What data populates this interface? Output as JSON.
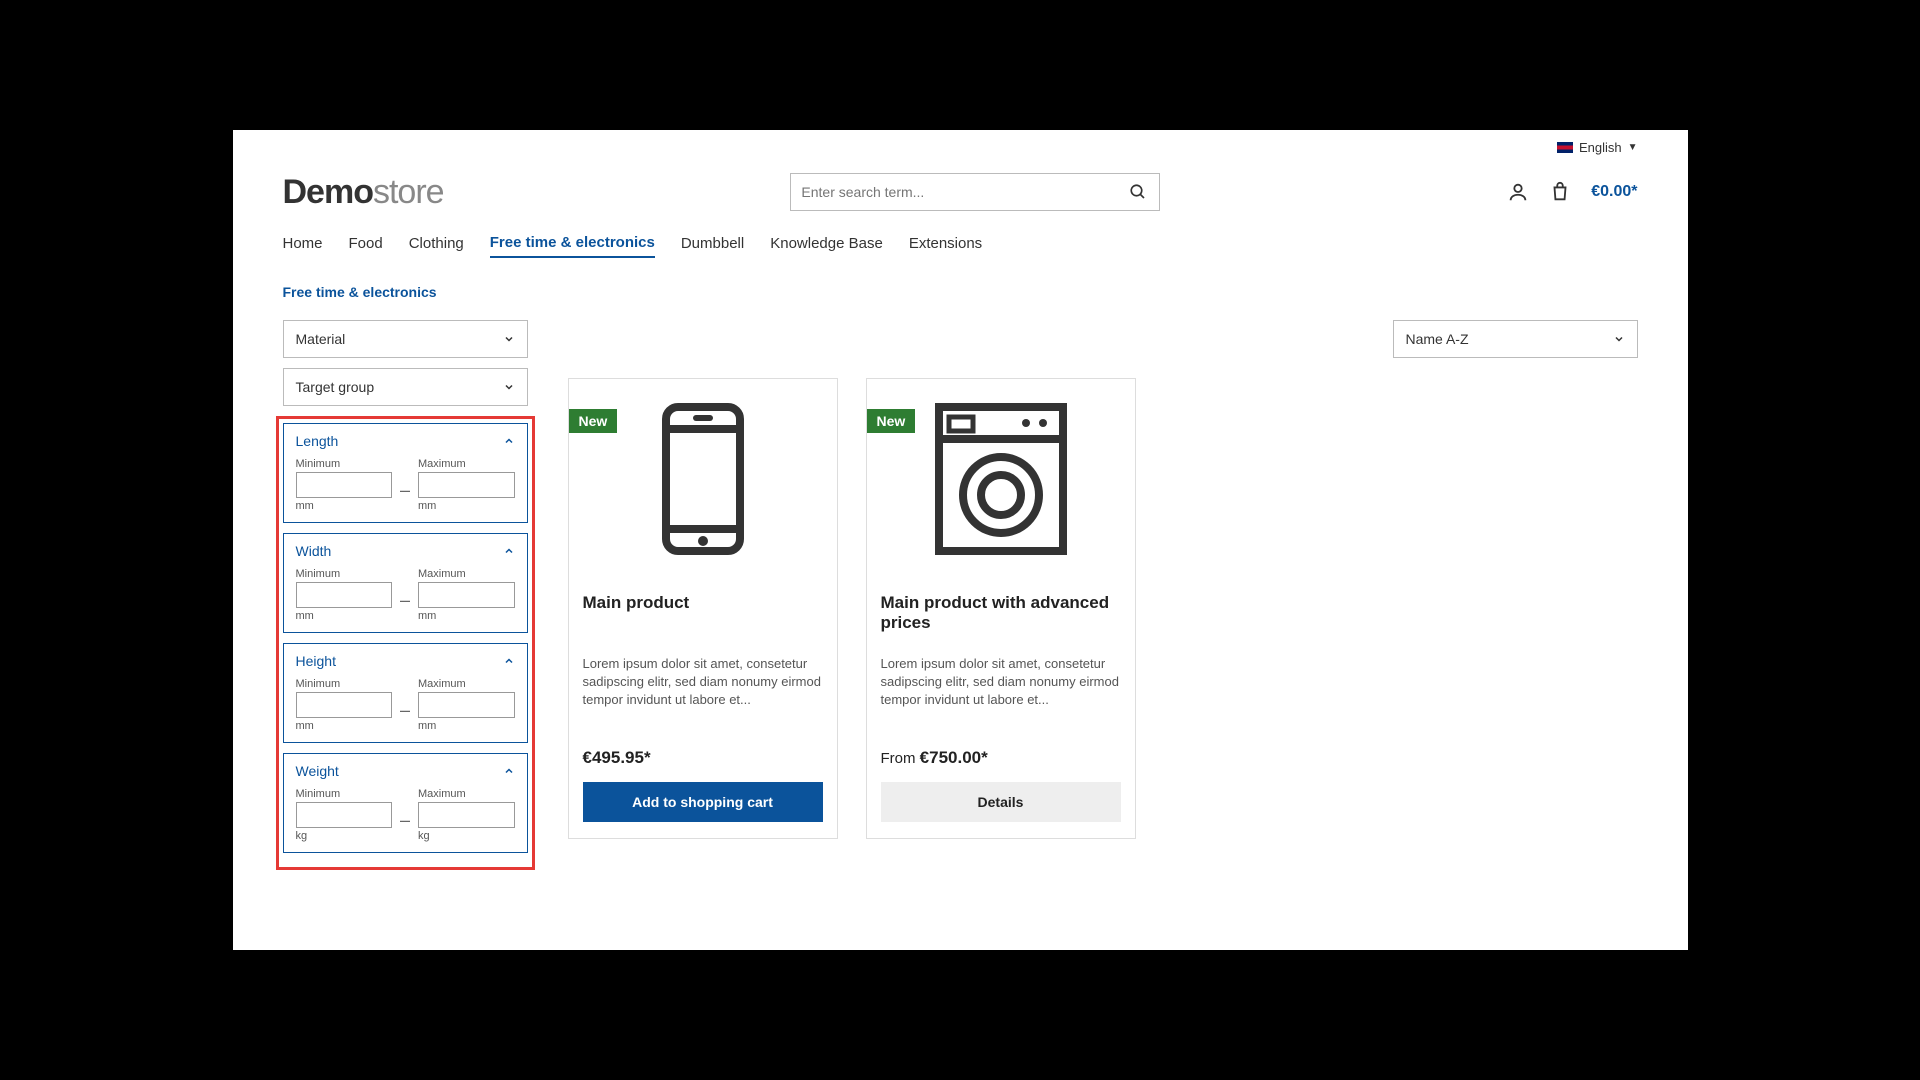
{
  "topbar": {
    "language": "English"
  },
  "logo": {
    "bold": "Demo",
    "light": "store"
  },
  "search": {
    "placeholder": "Enter search term..."
  },
  "cart": {
    "total": "€0.00*"
  },
  "nav": {
    "items": [
      "Home",
      "Food",
      "Clothing",
      "Free time & electronics",
      "Dumbbell",
      "Knowledge Base",
      "Extensions"
    ],
    "active_index": 3
  },
  "breadcrumb": "Free time & electronics",
  "filters": {
    "collapsed": [
      "Material",
      "Target group"
    ],
    "range": [
      {
        "label": "Length",
        "min_label": "Minimum",
        "max_label": "Maximum",
        "unit": "mm"
      },
      {
        "label": "Width",
        "min_label": "Minimum",
        "max_label": "Maximum",
        "unit": "mm"
      },
      {
        "label": "Height",
        "min_label": "Minimum",
        "max_label": "Maximum",
        "unit": "mm"
      },
      {
        "label": "Weight",
        "min_label": "Minimum",
        "max_label": "Maximum",
        "unit": "kg"
      }
    ]
  },
  "sort": {
    "selected": "Name A-Z"
  },
  "products": [
    {
      "badge": "New",
      "title": "Main product",
      "desc": "Lorem ipsum dolor sit amet, consetetur sadipscing elitr, sed diam nonumy eirmod tempor invidunt ut labore et...",
      "price": "€495.95*",
      "action": "Add to shopping cart",
      "action_style": "primary"
    },
    {
      "badge": "New",
      "title": "Main product with advanced prices",
      "desc": "Lorem ipsum dolor sit amet, consetetur sadipscing elitr, sed diam nonumy eirmod tempor invidunt ut labore et...",
      "price_prefix": "From ",
      "price": "€750.00*",
      "action": "Details",
      "action_style": "secondary"
    }
  ]
}
